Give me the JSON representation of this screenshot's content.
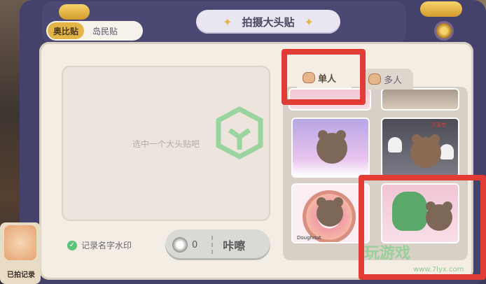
{
  "header": {
    "title": "拍摄大头贴",
    "mode_tabs": [
      {
        "label": "奥比贴",
        "active": true
      },
      {
        "label": "岛民贴",
        "active": false
      }
    ]
  },
  "preview": {
    "hint": "选中一个大头贴吧"
  },
  "watermark_option": {
    "label": "记录名字水印",
    "checked": true
  },
  "shoot_button": {
    "cost": "0",
    "label": "咔嚓"
  },
  "sticker_tabs": [
    {
      "label": "单人",
      "active": true
    },
    {
      "label": "多人",
      "active": false
    }
  ],
  "stickers": {
    "caption_donut": "Doughnut",
    "caption_halloween": "万圣节"
  },
  "history": {
    "label": "已拍记录"
  },
  "watermark": {
    "text": "玩游戏",
    "url": "www.7lyx.com"
  },
  "colors": {
    "accent": "#e3b548",
    "frame": "#44426a",
    "panel": "#f3ede4",
    "highlight": "#e33b35",
    "check": "#5cc37a"
  }
}
